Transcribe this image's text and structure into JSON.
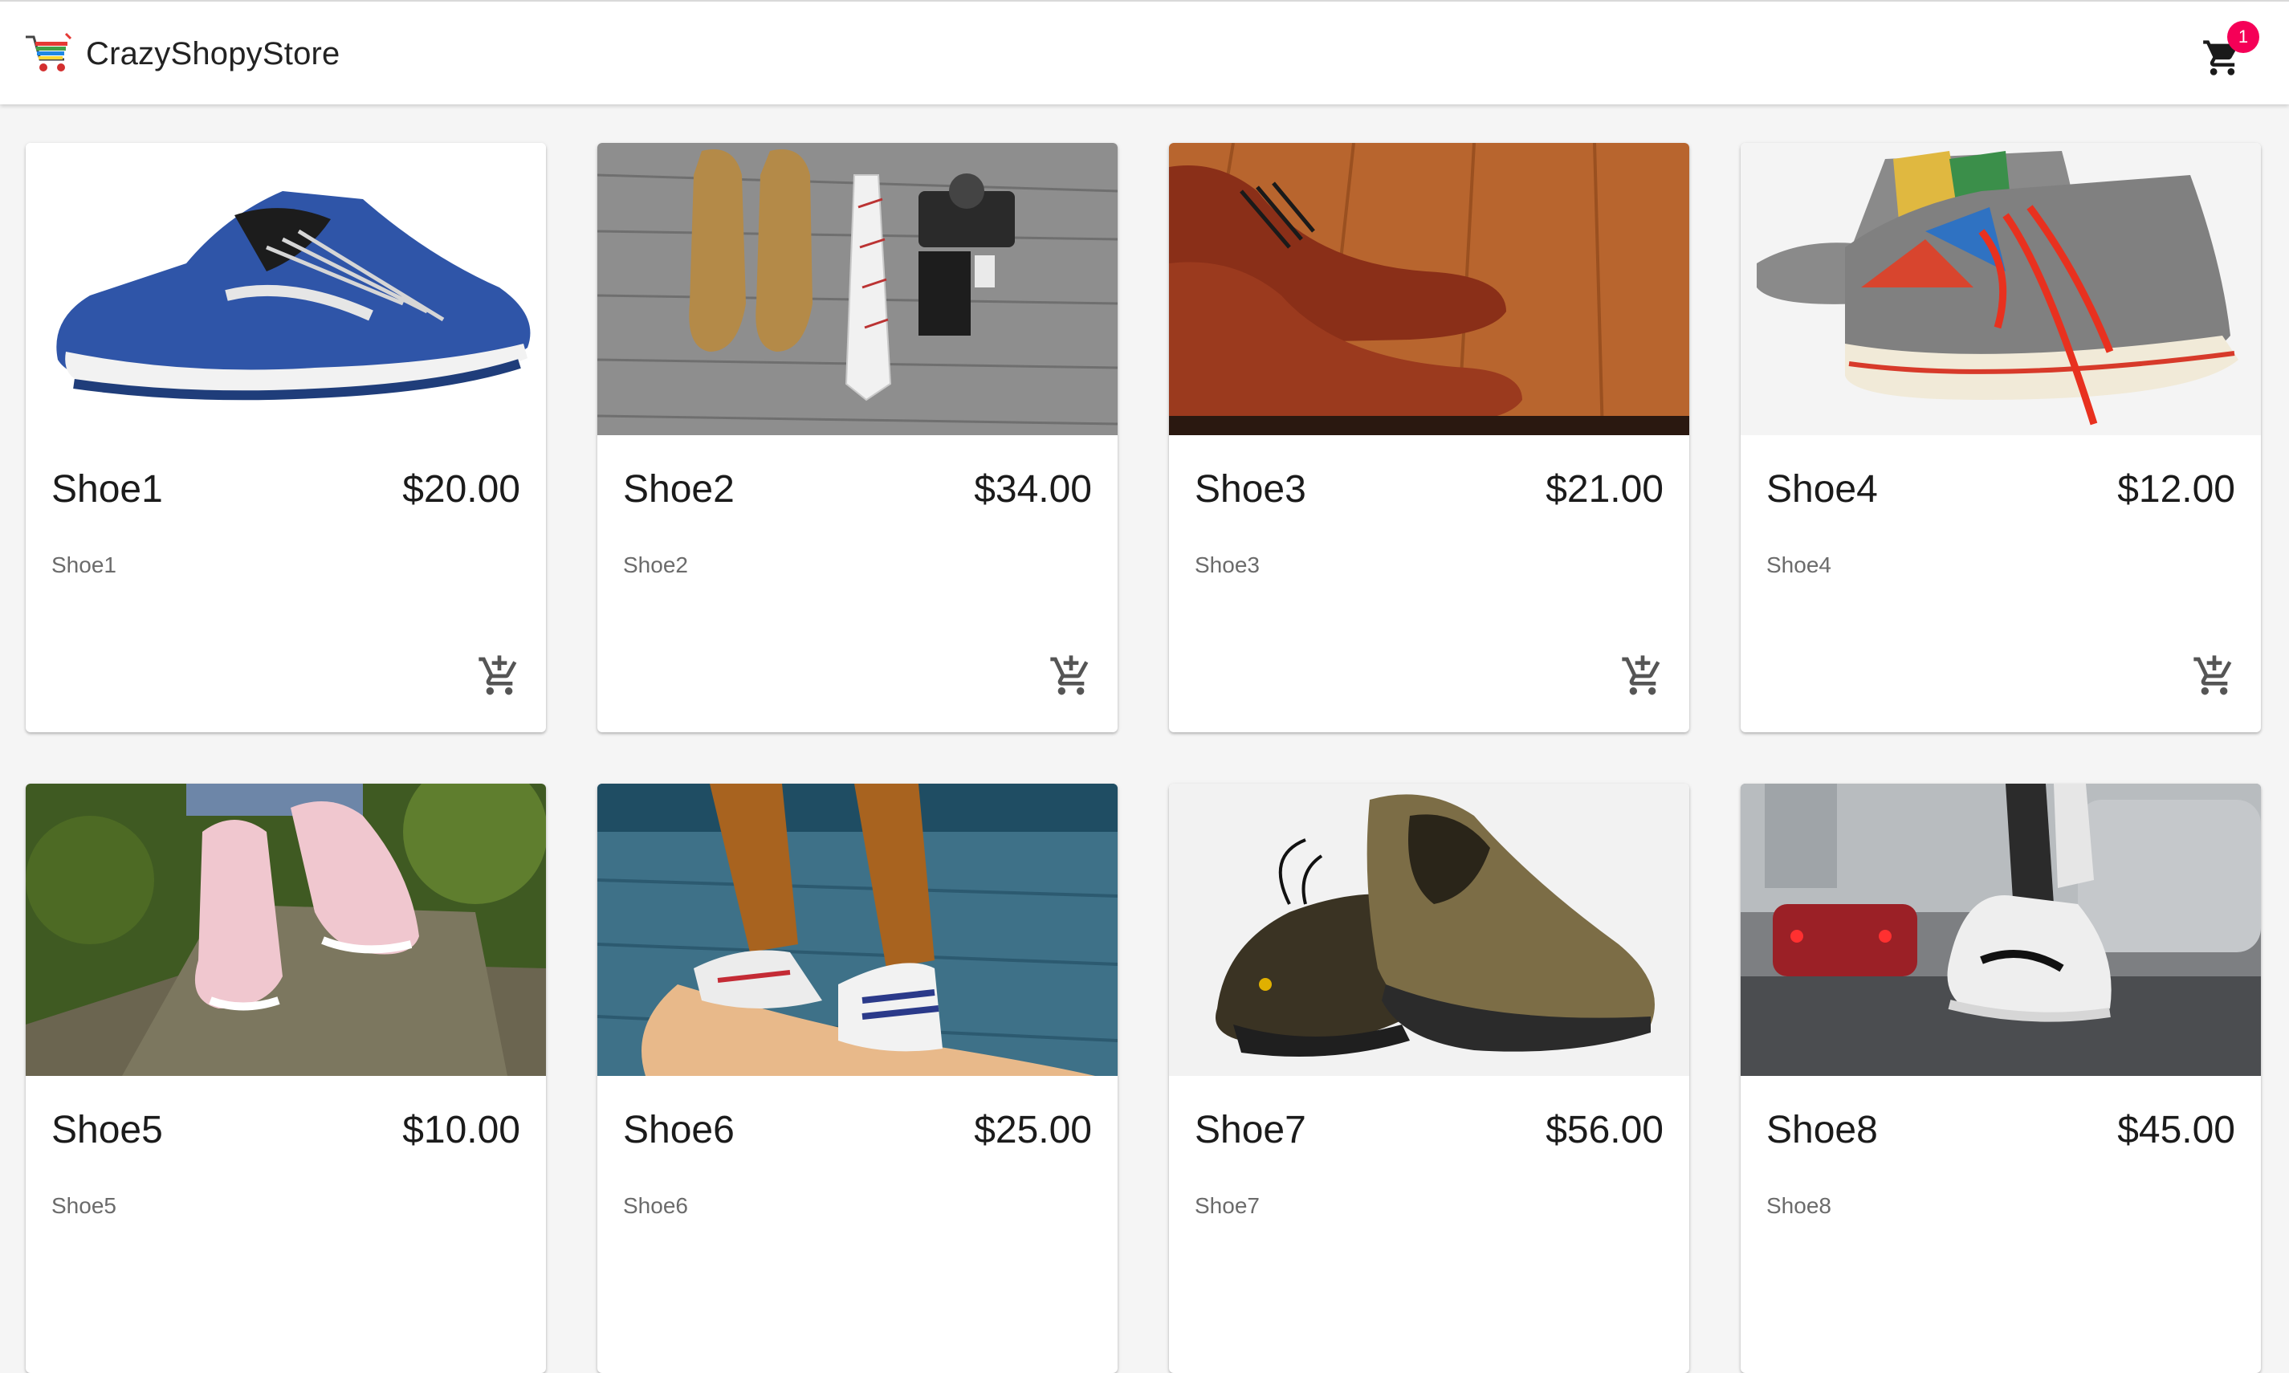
{
  "app": {
    "title": "CrazyShopyStore",
    "logo_icon": "shopping-cart-logo-icon",
    "cart_icon": "shopping-cart-icon",
    "cart_count": "1",
    "badge_color": "#f50057"
  },
  "products": [
    {
      "name": "Shoe1",
      "price": "$20.00",
      "description": "Shoe1",
      "image": "blue-running-shoe"
    },
    {
      "name": "Shoe2",
      "price": "$34.00",
      "description": "Shoe2",
      "image": "tan-brogues-with-tie-and-camera"
    },
    {
      "name": "Shoe3",
      "price": "$21.00",
      "description": "Shoe3",
      "image": "brown-leather-boots-on-wood-floor"
    },
    {
      "name": "Shoe4",
      "price": "$12.00",
      "description": "Shoe4",
      "image": "comic-print-high-top-sneakers"
    },
    {
      "name": "Shoe5",
      "price": "$10.00",
      "description": "Shoe5",
      "image": "pink-sneakers-on-log"
    },
    {
      "name": "Shoe6",
      "price": "$25.00",
      "description": "Shoe6",
      "image": "sneakers-on-skateboard"
    },
    {
      "name": "Shoe7",
      "price": "$56.00",
      "description": "Shoe7",
      "image": "hiking-shoes"
    },
    {
      "name": "Shoe8",
      "price": "$45.00",
      "description": "Shoe8",
      "image": "white-sneaker-on-wet-street"
    }
  ],
  "add_to_cart_icon": "add-shopping-cart-icon"
}
